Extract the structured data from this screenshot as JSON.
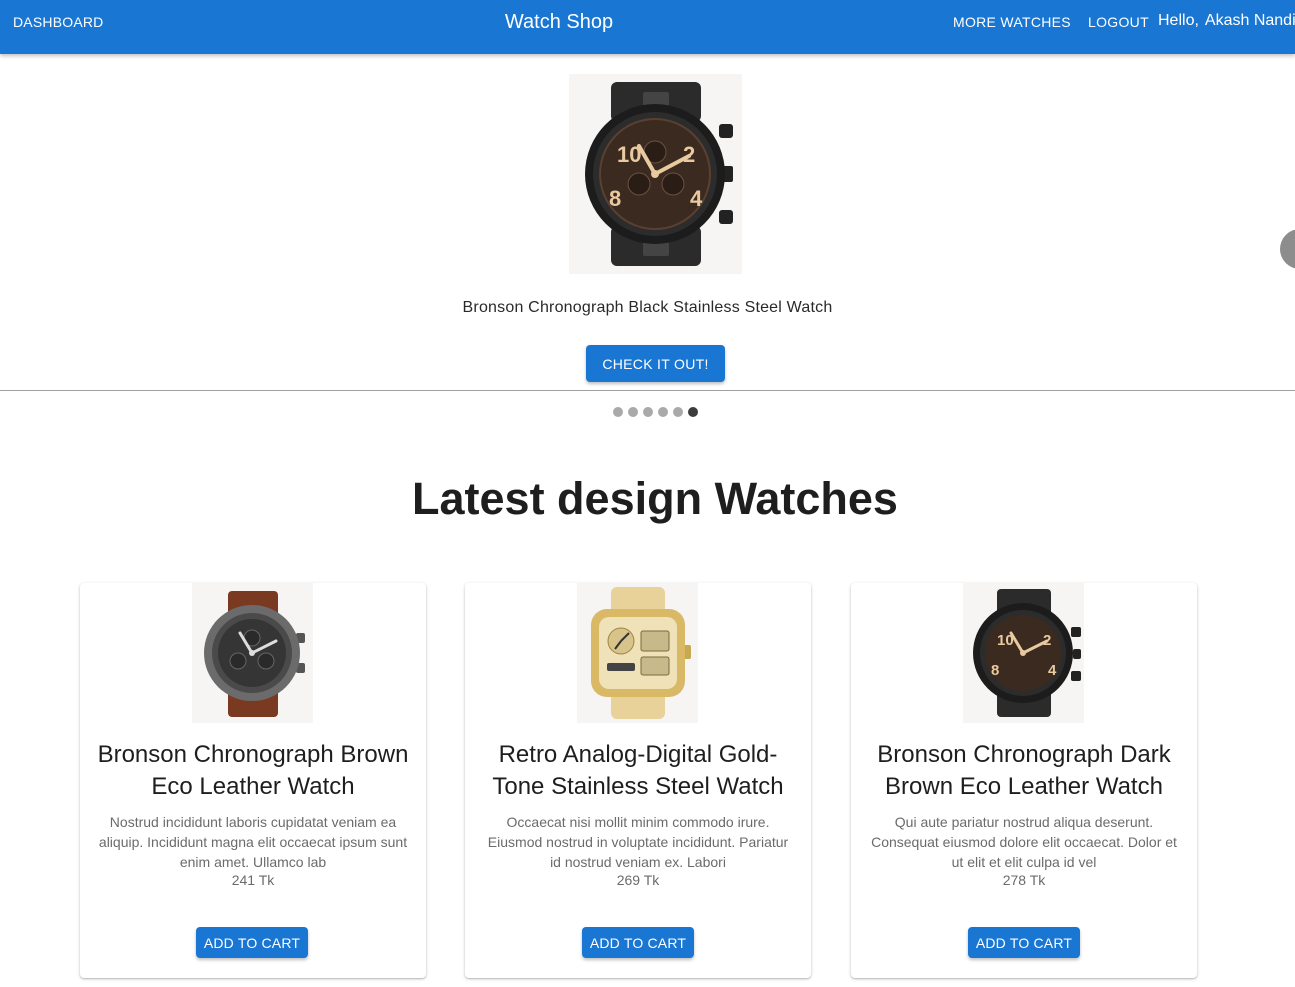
{
  "header": {
    "dashboard_label": "DASHBOARD",
    "brand": "Watch Shop",
    "more_label": "MORE WATCHES",
    "logout_label": "LOGOUT",
    "greeting": "Hello,",
    "user_name": "Akash Nandi",
    "bar_color": "#1976d2"
  },
  "carousel": {
    "caption": "Bronson Chronograph Black Stainless Steel Watch",
    "button_label": "CHECK IT OUT!",
    "slide_count": 6,
    "active_slide": 6,
    "image_icon": "black-chronograph-watch"
  },
  "section": {
    "title": "Latest design Watches"
  },
  "products": [
    {
      "title": "Bronson Chronograph Brown Eco Leather Watch",
      "description": "Nostrud incididunt laboris cupidatat veniam ea aliquip. Incididunt magna elit occaecat ipsum sunt enim amet. Ullamco lab",
      "price": "241 Tk",
      "button_label": "ADD TO CART",
      "image_icon": "grey-chronograph-brown-strap-watch"
    },
    {
      "title": "Retro Analog-Digital Gold-Tone Stainless Steel Watch",
      "description": "Occaecat nisi mollit minim commodo irure. Eiusmod nostrud in voluptate incididunt. Pariatur id nostrud veniam ex. Labori",
      "price": "269 Tk",
      "button_label": "ADD TO CART",
      "image_icon": "gold-analog-digital-watch"
    },
    {
      "title": "Bronson Chronograph Dark Brown Eco Leather Watch",
      "description": "Qui aute pariatur nostrud aliqua deserunt. Consequat eiusmod dolore elit occaecat. Dolor et ut elit et elit culpa id vel",
      "price": "278 Tk",
      "button_label": "ADD TO CART",
      "image_icon": "dark-brown-chronograph-watch"
    }
  ]
}
